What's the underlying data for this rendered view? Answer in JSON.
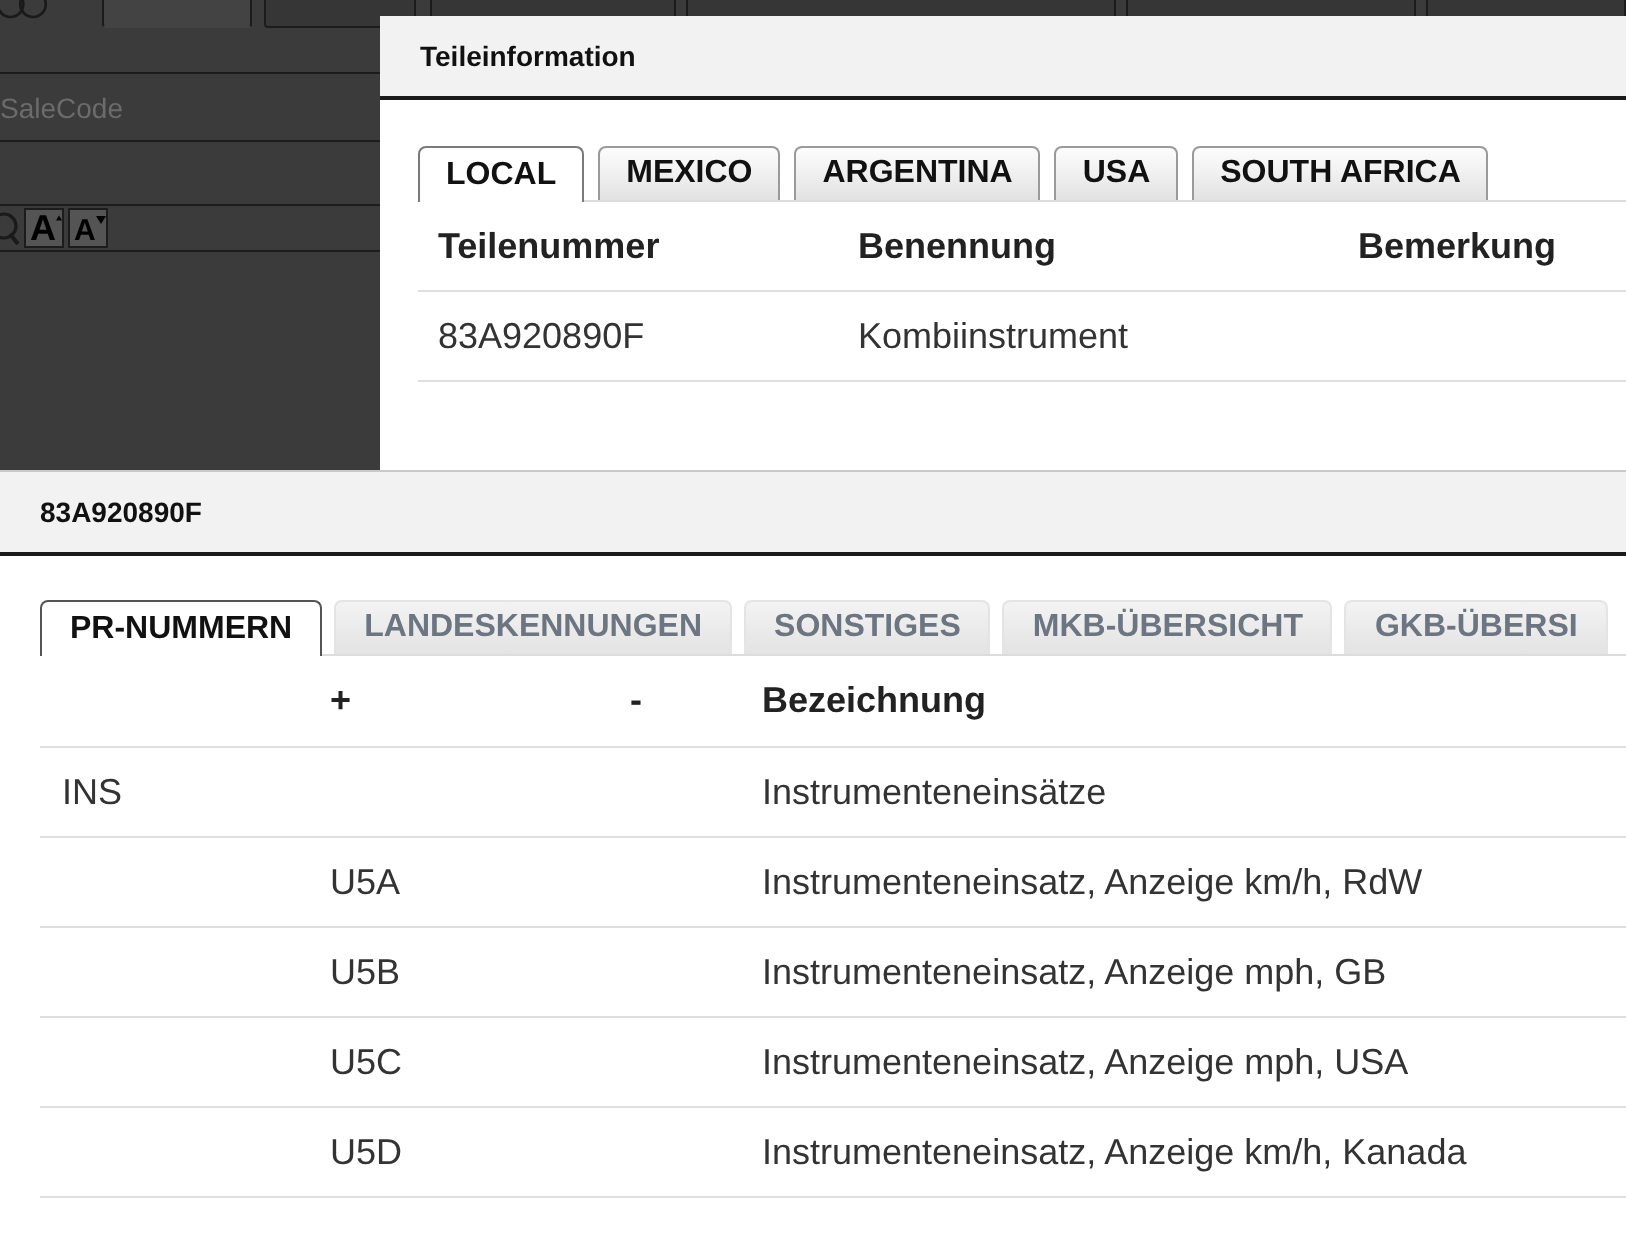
{
  "background_app": {
    "tabs": [
      {
        "selected": true
      },
      {
        "selected": false
      },
      {
        "selected": false
      },
      {
        "selected": false
      },
      {
        "selected": false
      },
      {
        "selected": false
      }
    ],
    "sale_code_field": {
      "placeholder": "SaleCode"
    },
    "toolbar": [
      {
        "kind": "zoom"
      },
      {
        "kind": "font_larger",
        "label": "A"
      },
      {
        "kind": "font_smaller",
        "label": "A"
      }
    ]
  },
  "windows": [
    {
      "title": "Teileinformation",
      "tabs": [
        {
          "label": "LOCAL",
          "selected": true
        },
        {
          "label": "MEXICO",
          "selected": false
        },
        {
          "label": "ARGENTINA",
          "selected": false
        },
        {
          "label": "USA",
          "selected": false
        },
        {
          "label": "SOUTH AFRICA",
          "selected": false
        }
      ],
      "table": {
        "header": {
          "teilenummer": "Teilenummer",
          "benennung": "Benennung",
          "bemerkung": "Bemerkung"
        },
        "rows": [
          {
            "teilenummer": "83A920890F",
            "benennung": "Kombiinstrument"
          }
        ]
      }
    },
    {
      "title": "83A920890F",
      "tabs": [
        {
          "label": "PR-NUMMERN",
          "selected": true
        },
        {
          "label": "LANDESKENNUNGEN",
          "selected": false
        },
        {
          "label": "SONSTIGES",
          "selected": false
        },
        {
          "label": "MKB-ÜBERSICHT",
          "selected": false
        },
        {
          "label": "GKB-ÜBERSI",
          "selected": false
        }
      ],
      "table": {
        "header": {
          "plus": "+",
          "minus": "-",
          "bezeichnung": "Bezeichnung"
        },
        "rows": [
          {
            "column_1": "INS",
            "bezeichnung": "Instrumenteneinsätze"
          },
          {
            "plus": "U5A",
            "bezeichnung": "Instrumenteneinsatz, Anzeige km/h, RdW"
          },
          {
            "plus": "U5B",
            "bezeichnung": "Instrumenteneinsatz, Anzeige mph, GB"
          },
          {
            "plus": "U5C",
            "bezeichnung": "Instrumenteneinsatz, Anzeige mph, USA"
          },
          {
            "plus": "U5D",
            "bezeichnung": "Instrumenteneinsatz, Anzeige km/h, Kanada"
          }
        ]
      }
    }
  ]
}
